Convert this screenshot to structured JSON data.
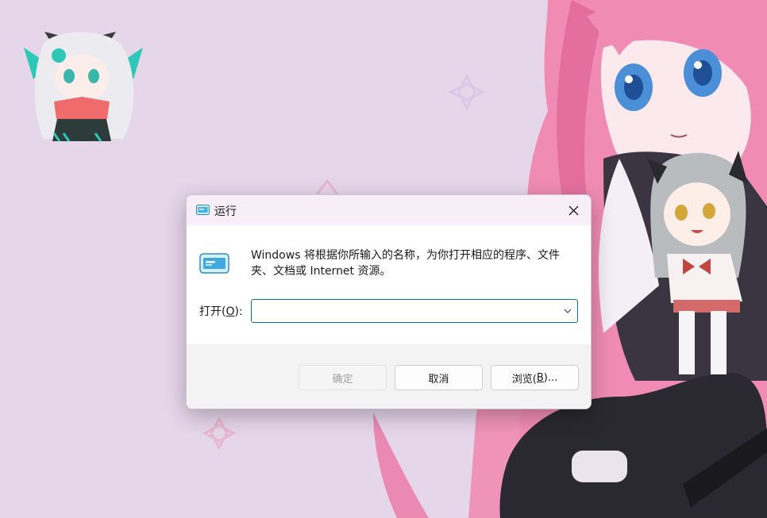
{
  "dialog": {
    "title": "运行",
    "description": "Windows 将根据你所输入的名称，为你打开相应的程序、文件夹、文档或 Internet 资源。",
    "open_label_prefix": "打开(",
    "open_label_key": "O",
    "open_label_suffix": "):",
    "input_value": "",
    "buttons": {
      "ok": "确定",
      "cancel": "取消",
      "browse_prefix": "浏览(",
      "browse_key": "B",
      "browse_suffix": ")..."
    }
  },
  "colors": {
    "accent": "#0f6cbd",
    "wallpaper": "#e6d6ea",
    "titlebar": "#f7eef8"
  },
  "icons": {
    "title": "run-icon",
    "close": "close-icon",
    "dropdown": "chevron-down-icon"
  }
}
